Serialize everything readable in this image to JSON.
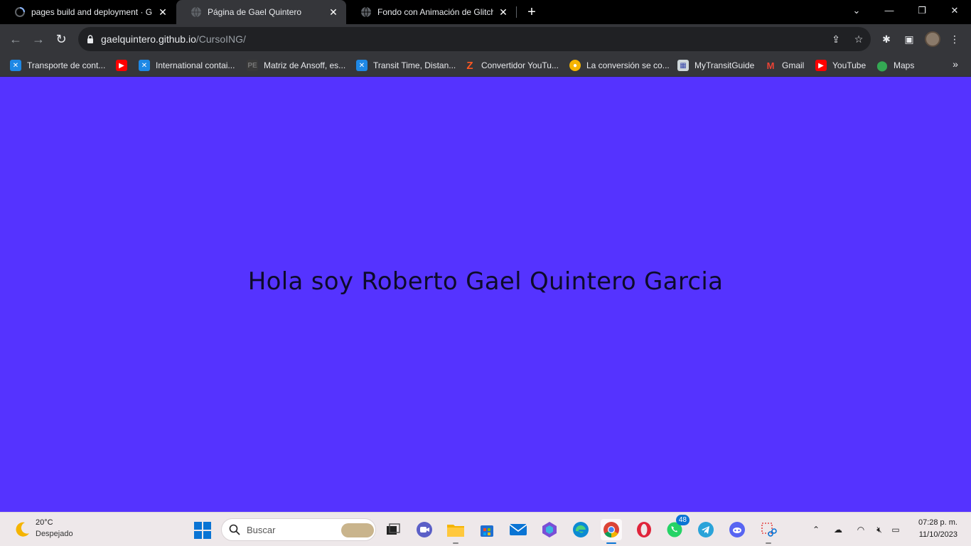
{
  "tabs": [
    {
      "title": "pages build and deployment · G",
      "close": "✕"
    },
    {
      "title": "Página de Gael Quintero",
      "close": "✕"
    },
    {
      "title": "Fondo con Animación de Glitch",
      "close": "✕"
    }
  ],
  "new_tab": "+",
  "window_controls": {
    "tab_search": "⌄",
    "minimize": "—",
    "restore": "❐",
    "close": "✕"
  },
  "nav": {
    "back": "←",
    "forward": "→",
    "reload": "↻"
  },
  "address": {
    "domain": "gaelquintero.github.io",
    "path": "/CursoING/"
  },
  "omnibox_icons": {
    "share": "⇪",
    "bookmark": "☆"
  },
  "toolbar_icons": {
    "extensions": "✱",
    "side_panel": "▣",
    "menu": "⋮"
  },
  "bookmarks": [
    {
      "label": "Transporte de cont...",
      "icon": "grid-icon",
      "color": "#1e88e5"
    },
    {
      "label": "",
      "icon": "youtube-icon",
      "color": "#ff0000"
    },
    {
      "label": "International contai...",
      "icon": "grid-icon",
      "color": "#1e88e5"
    },
    {
      "label": "Matriz de Ansoff, es...",
      "icon": "pe-icon",
      "color": "#3a3a3a"
    },
    {
      "label": "Transit Time, Distan...",
      "icon": "grid-icon",
      "color": "#1e88e5"
    },
    {
      "label": "Convertidor YouTu...",
      "icon": "z-icon",
      "color": "#ff5722"
    },
    {
      "label": "La conversión se co...",
      "icon": "camera-icon",
      "color": "#f5b400"
    },
    {
      "label": "MyTransitGuide",
      "icon": "map-doc-icon",
      "color": "#cfd8dc"
    },
    {
      "label": "Gmail",
      "icon": "gmail-icon",
      "color": "#ea4335"
    },
    {
      "label": "YouTube",
      "icon": "youtube-icon",
      "color": "#ff0000"
    },
    {
      "label": "Maps",
      "icon": "maps-pin-icon",
      "color": "#34a853"
    }
  ],
  "bookmarks_more": "»",
  "page": {
    "background": "#5533ff",
    "headline": "Hola soy Roberto Gael Quintero Garcia"
  },
  "taskbar": {
    "weather_temp": "20°C",
    "weather_desc": "Despejado",
    "search_placeholder": "Buscar",
    "whatsapp_badge": "48",
    "clock_time": "07:28 p. m.",
    "clock_date": "11/10/2023"
  }
}
